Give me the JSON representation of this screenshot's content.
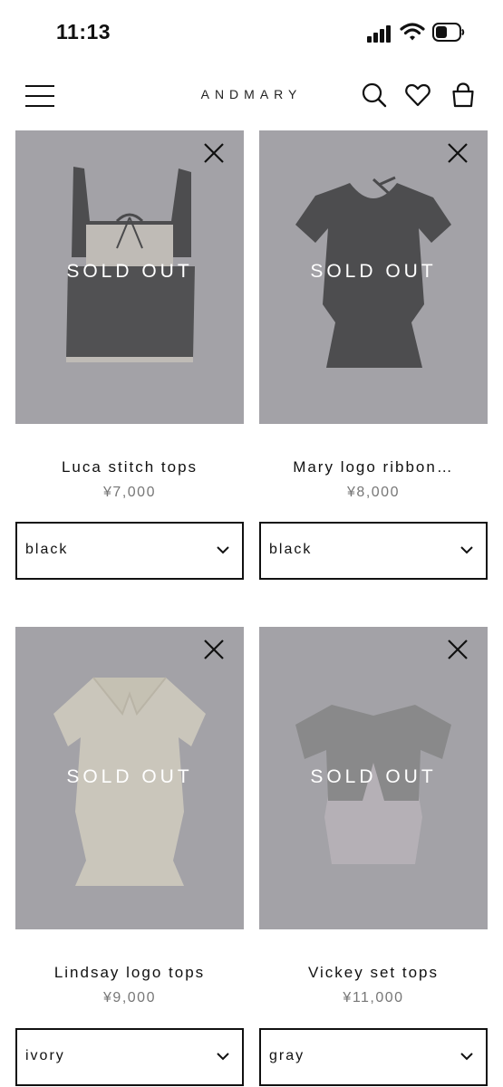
{
  "status_bar": {
    "time": "11:13"
  },
  "header": {
    "brand": "ANDMARY"
  },
  "products": [
    {
      "name": "Luca stitch tops",
      "price": "¥7,000",
      "badge": "SOLD OUT",
      "color": "black"
    },
    {
      "name": "Mary logo ribbon…",
      "price": "¥8,000",
      "badge": "SOLD OUT",
      "color": "black"
    },
    {
      "name": "Lindsay logo tops",
      "price": "¥9,000",
      "badge": "SOLD OUT",
      "color": "ivory"
    },
    {
      "name": "Vickey set tops",
      "price": "¥11,000",
      "badge": "SOLD OUT",
      "color": "gray"
    }
  ],
  "colors": {
    "image_background": "#a9a8ad",
    "text": "#111111",
    "price": "#777777"
  }
}
